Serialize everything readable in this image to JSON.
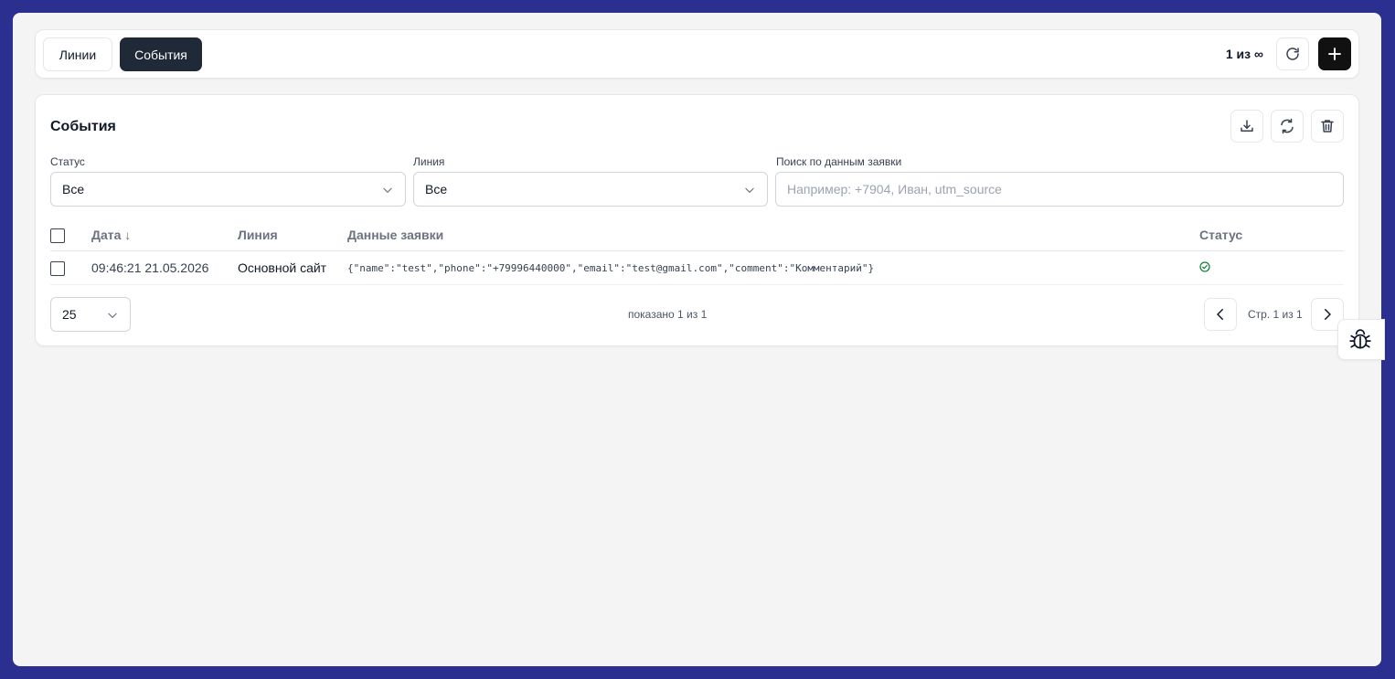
{
  "tabs": {
    "lines_label": "Линии",
    "events_label": "События"
  },
  "header": {
    "counter": "1 из ∞"
  },
  "card": {
    "title": "События"
  },
  "filters": {
    "status_label": "Статус",
    "status_value": "Все",
    "line_label": "Линия",
    "line_value": "Все",
    "search_label": "Поиск по данным заявки",
    "search_placeholder": "Например: +7904, Иван, utm_source",
    "search_value": ""
  },
  "table": {
    "columns": {
      "date": "Дата ↓",
      "line": "Линия",
      "data": "Данные заявки",
      "status": "Статус"
    },
    "rows": [
      {
        "date": "09:46:21 21.05.2026",
        "line": "Основной сайт",
        "data": "{\"name\":\"test\",\"phone\":\"+79996440000\",\"email\":\"test@gmail.com\",\"comment\":\"Комментарий\"}",
        "status_icon": "check-circle-icon"
      }
    ]
  },
  "pagination": {
    "page_size": "25",
    "shown": "показано 1 из 1",
    "page_label": "Стр. 1 из 1"
  },
  "colors": {
    "frame_background": "#2b2f8f",
    "active_tab": "#1f2937",
    "add_button": "#111111",
    "status_ok": "#15803d"
  },
  "icons": {
    "reload": "reload-icon",
    "add": "plus-icon",
    "download": "download-icon",
    "sync": "sync-icon",
    "delete": "trash-icon",
    "debug": "bug-icon"
  }
}
